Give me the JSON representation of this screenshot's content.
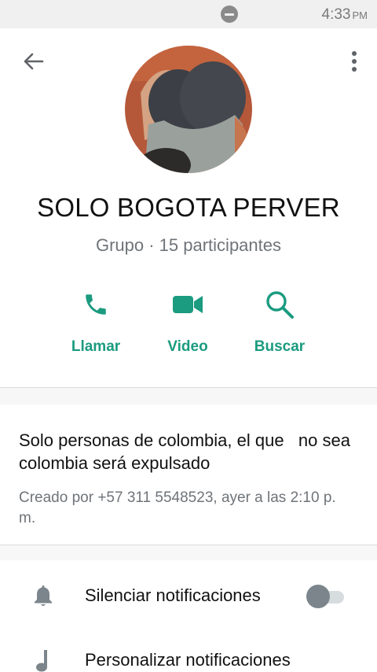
{
  "status_bar": {
    "time": "4:33",
    "ampm": "PM",
    "icons": [
      "do-not-disturb-icon"
    ]
  },
  "header": {
    "back_icon": "arrow-left-icon",
    "menu_icon": "more-vert-icon"
  },
  "group": {
    "name": "SOLO BOGOTA PERVER",
    "subtitle": "Grupo · 15 participantes"
  },
  "actions": [
    {
      "label": "Llamar",
      "icon": "phone-icon"
    },
    {
      "label": "Video",
      "icon": "videocam-icon"
    },
    {
      "label": "Buscar",
      "icon": "search-icon"
    }
  ],
  "description": {
    "text": "Solo personas de colombia, el que   no sea colombia será expulsado",
    "created": "Creado por +57 311 5548523, ayer a las 2:10 p. m."
  },
  "settings": [
    {
      "label": "Silenciar notificaciones",
      "icon": "bell-icon",
      "toggle": false
    },
    {
      "label": "Personalizar notificaciones",
      "icon": "music-note-icon"
    }
  ],
  "colors": {
    "accent": "#1b9b80",
    "secondary_text": "#6f7479",
    "icon_gray": "#7b858b"
  }
}
